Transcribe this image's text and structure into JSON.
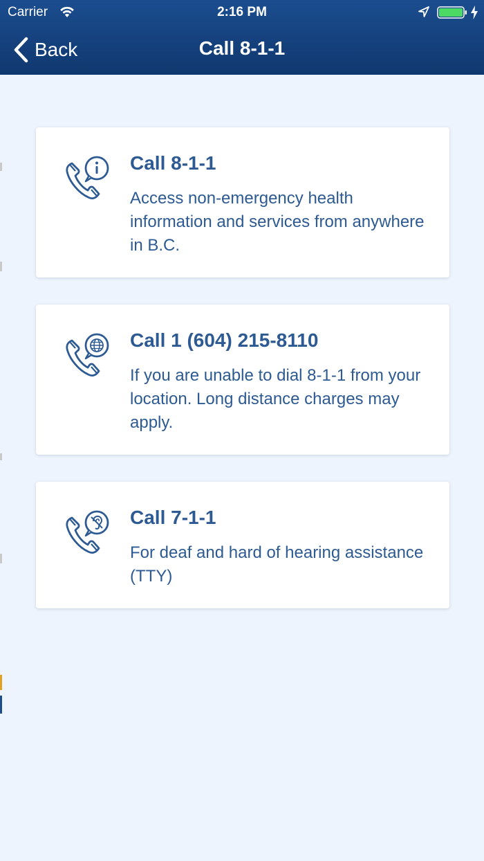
{
  "status_bar": {
    "carrier": "Carrier",
    "time": "2:16 PM"
  },
  "nav": {
    "back_label": "Back",
    "title": "Call 8-1-1"
  },
  "cards": [
    {
      "icon": "phone-info-icon",
      "title": "Call 8-1-1",
      "description": "Access non-emergency health information and services from anywhere in B.C."
    },
    {
      "icon": "phone-globe-icon",
      "title": "Call 1 (604) 215-8110",
      "description": "If you are unable to dial 8-1-1 from your location. Long distance charges may apply."
    },
    {
      "icon": "phone-hearing-impaired-icon",
      "title": "Call 7-1-1",
      "description": "For deaf and hard of hearing assistance (TTY)"
    }
  ],
  "colors": {
    "navbar": "#17437f",
    "background": "#eef4fd",
    "card_text": "#2d5a92",
    "battery": "#4cd964"
  }
}
